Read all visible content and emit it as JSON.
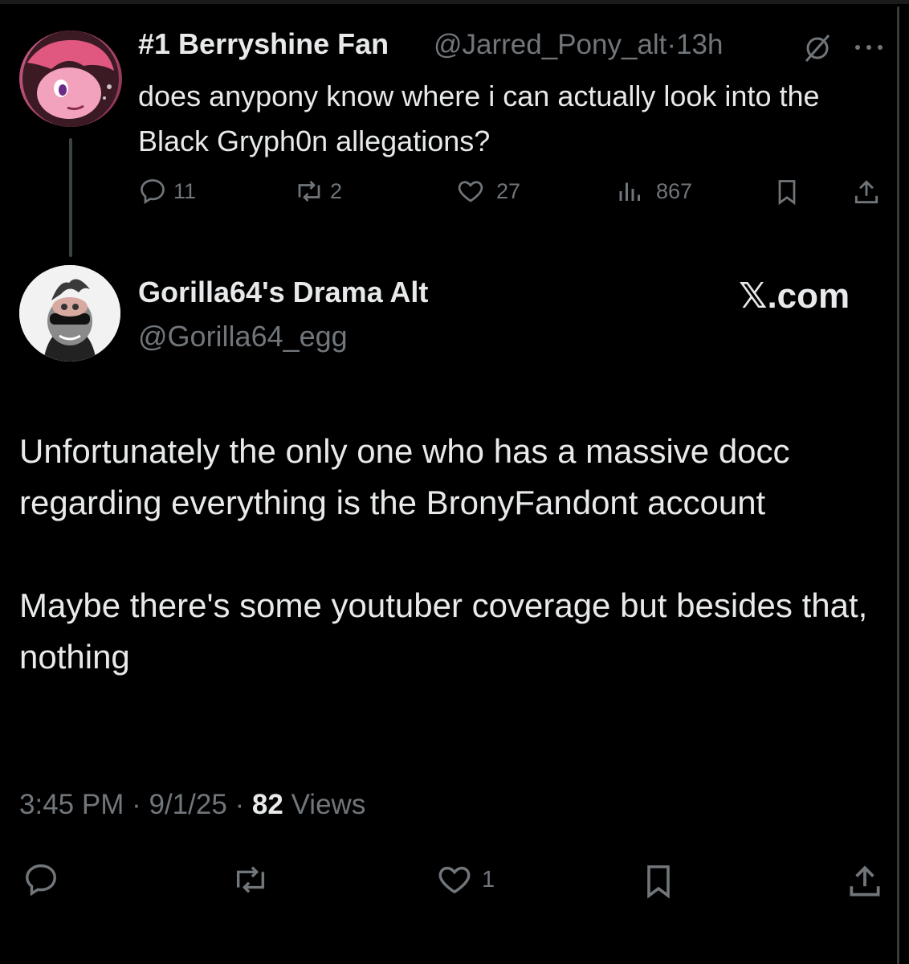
{
  "parent_post": {
    "display_name": "#1 Berryshine Fan",
    "handle": "@Jarred_Pony_alt",
    "separator": "·",
    "time_ago": "13h",
    "text": "does anypony know where i can actually look into the Black Gryph0n allegations?",
    "actions": {
      "replies": "11",
      "reposts": "2",
      "likes": "27",
      "views": "867"
    }
  },
  "main_post": {
    "display_name": "Gorilla64's Drama Alt",
    "handle": "@Gorilla64_egg",
    "brand": "𝕏.com",
    "paragraph_1": "Unfortunately the only one who has a massive docc regarding everything is the BronyFandont account",
    "paragraph_2": "Maybe there's some youtuber coverage but besides that,  nothing",
    "time": "3:45 PM",
    "date": "9/1/25",
    "dot": "·",
    "views_count": "82",
    "views_label": "Views",
    "likes": "1"
  },
  "colors": {
    "background": "#000000",
    "text": "#e7e9ea",
    "muted": "#71767b"
  }
}
